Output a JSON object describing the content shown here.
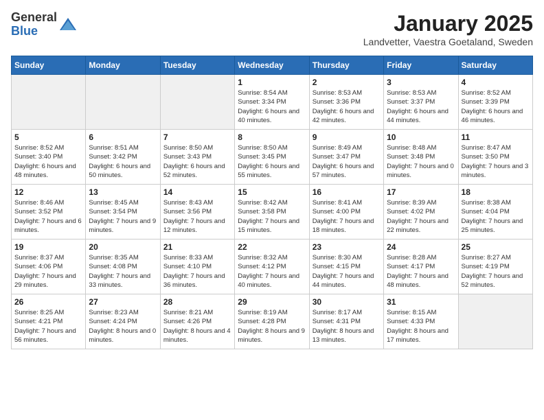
{
  "logo": {
    "general": "General",
    "blue": "Blue"
  },
  "title": "January 2025",
  "location": "Landvetter, Vaestra Goetaland, Sweden",
  "days_header": [
    "Sunday",
    "Monday",
    "Tuesday",
    "Wednesday",
    "Thursday",
    "Friday",
    "Saturday"
  ],
  "weeks": [
    [
      {
        "day": "",
        "sunrise": "",
        "sunset": "",
        "daylight": "",
        "empty": true
      },
      {
        "day": "",
        "sunrise": "",
        "sunset": "",
        "daylight": "",
        "empty": true
      },
      {
        "day": "",
        "sunrise": "",
        "sunset": "",
        "daylight": "",
        "empty": true
      },
      {
        "day": "1",
        "sunrise": "Sunrise: 8:54 AM",
        "sunset": "Sunset: 3:34 PM",
        "daylight": "Daylight: 6 hours and 40 minutes.",
        "empty": false
      },
      {
        "day": "2",
        "sunrise": "Sunrise: 8:53 AM",
        "sunset": "Sunset: 3:36 PM",
        "daylight": "Daylight: 6 hours and 42 minutes.",
        "empty": false
      },
      {
        "day": "3",
        "sunrise": "Sunrise: 8:53 AM",
        "sunset": "Sunset: 3:37 PM",
        "daylight": "Daylight: 6 hours and 44 minutes.",
        "empty": false
      },
      {
        "day": "4",
        "sunrise": "Sunrise: 8:52 AM",
        "sunset": "Sunset: 3:39 PM",
        "daylight": "Daylight: 6 hours and 46 minutes.",
        "empty": false
      }
    ],
    [
      {
        "day": "5",
        "sunrise": "Sunrise: 8:52 AM",
        "sunset": "Sunset: 3:40 PM",
        "daylight": "Daylight: 6 hours and 48 minutes.",
        "empty": false
      },
      {
        "day": "6",
        "sunrise": "Sunrise: 8:51 AM",
        "sunset": "Sunset: 3:42 PM",
        "daylight": "Daylight: 6 hours and 50 minutes.",
        "empty": false
      },
      {
        "day": "7",
        "sunrise": "Sunrise: 8:50 AM",
        "sunset": "Sunset: 3:43 PM",
        "daylight": "Daylight: 6 hours and 52 minutes.",
        "empty": false
      },
      {
        "day": "8",
        "sunrise": "Sunrise: 8:50 AM",
        "sunset": "Sunset: 3:45 PM",
        "daylight": "Daylight: 6 hours and 55 minutes.",
        "empty": false
      },
      {
        "day": "9",
        "sunrise": "Sunrise: 8:49 AM",
        "sunset": "Sunset: 3:47 PM",
        "daylight": "Daylight: 6 hours and 57 minutes.",
        "empty": false
      },
      {
        "day": "10",
        "sunrise": "Sunrise: 8:48 AM",
        "sunset": "Sunset: 3:48 PM",
        "daylight": "Daylight: 7 hours and 0 minutes.",
        "empty": false
      },
      {
        "day": "11",
        "sunrise": "Sunrise: 8:47 AM",
        "sunset": "Sunset: 3:50 PM",
        "daylight": "Daylight: 7 hours and 3 minutes.",
        "empty": false
      }
    ],
    [
      {
        "day": "12",
        "sunrise": "Sunrise: 8:46 AM",
        "sunset": "Sunset: 3:52 PM",
        "daylight": "Daylight: 7 hours and 6 minutes.",
        "empty": false
      },
      {
        "day": "13",
        "sunrise": "Sunrise: 8:45 AM",
        "sunset": "Sunset: 3:54 PM",
        "daylight": "Daylight: 7 hours and 9 minutes.",
        "empty": false
      },
      {
        "day": "14",
        "sunrise": "Sunrise: 8:43 AM",
        "sunset": "Sunset: 3:56 PM",
        "daylight": "Daylight: 7 hours and 12 minutes.",
        "empty": false
      },
      {
        "day": "15",
        "sunrise": "Sunrise: 8:42 AM",
        "sunset": "Sunset: 3:58 PM",
        "daylight": "Daylight: 7 hours and 15 minutes.",
        "empty": false
      },
      {
        "day": "16",
        "sunrise": "Sunrise: 8:41 AM",
        "sunset": "Sunset: 4:00 PM",
        "daylight": "Daylight: 7 hours and 18 minutes.",
        "empty": false
      },
      {
        "day": "17",
        "sunrise": "Sunrise: 8:39 AM",
        "sunset": "Sunset: 4:02 PM",
        "daylight": "Daylight: 7 hours and 22 minutes.",
        "empty": false
      },
      {
        "day": "18",
        "sunrise": "Sunrise: 8:38 AM",
        "sunset": "Sunset: 4:04 PM",
        "daylight": "Daylight: 7 hours and 25 minutes.",
        "empty": false
      }
    ],
    [
      {
        "day": "19",
        "sunrise": "Sunrise: 8:37 AM",
        "sunset": "Sunset: 4:06 PM",
        "daylight": "Daylight: 7 hours and 29 minutes.",
        "empty": false
      },
      {
        "day": "20",
        "sunrise": "Sunrise: 8:35 AM",
        "sunset": "Sunset: 4:08 PM",
        "daylight": "Daylight: 7 hours and 33 minutes.",
        "empty": false
      },
      {
        "day": "21",
        "sunrise": "Sunrise: 8:33 AM",
        "sunset": "Sunset: 4:10 PM",
        "daylight": "Daylight: 7 hours and 36 minutes.",
        "empty": false
      },
      {
        "day": "22",
        "sunrise": "Sunrise: 8:32 AM",
        "sunset": "Sunset: 4:12 PM",
        "daylight": "Daylight: 7 hours and 40 minutes.",
        "empty": false
      },
      {
        "day": "23",
        "sunrise": "Sunrise: 8:30 AM",
        "sunset": "Sunset: 4:15 PM",
        "daylight": "Daylight: 7 hours and 44 minutes.",
        "empty": false
      },
      {
        "day": "24",
        "sunrise": "Sunrise: 8:28 AM",
        "sunset": "Sunset: 4:17 PM",
        "daylight": "Daylight: 7 hours and 48 minutes.",
        "empty": false
      },
      {
        "day": "25",
        "sunrise": "Sunrise: 8:27 AM",
        "sunset": "Sunset: 4:19 PM",
        "daylight": "Daylight: 7 hours and 52 minutes.",
        "empty": false
      }
    ],
    [
      {
        "day": "26",
        "sunrise": "Sunrise: 8:25 AM",
        "sunset": "Sunset: 4:21 PM",
        "daylight": "Daylight: 7 hours and 56 minutes.",
        "empty": false
      },
      {
        "day": "27",
        "sunrise": "Sunrise: 8:23 AM",
        "sunset": "Sunset: 4:24 PM",
        "daylight": "Daylight: 8 hours and 0 minutes.",
        "empty": false
      },
      {
        "day": "28",
        "sunrise": "Sunrise: 8:21 AM",
        "sunset": "Sunset: 4:26 PM",
        "daylight": "Daylight: 8 hours and 4 minutes.",
        "empty": false
      },
      {
        "day": "29",
        "sunrise": "Sunrise: 8:19 AM",
        "sunset": "Sunset: 4:28 PM",
        "daylight": "Daylight: 8 hours and 9 minutes.",
        "empty": false
      },
      {
        "day": "30",
        "sunrise": "Sunrise: 8:17 AM",
        "sunset": "Sunset: 4:31 PM",
        "daylight": "Daylight: 8 hours and 13 minutes.",
        "empty": false
      },
      {
        "day": "31",
        "sunrise": "Sunrise: 8:15 AM",
        "sunset": "Sunset: 4:33 PM",
        "daylight": "Daylight: 8 hours and 17 minutes.",
        "empty": false
      },
      {
        "day": "",
        "sunrise": "",
        "sunset": "",
        "daylight": "",
        "empty": true
      }
    ]
  ]
}
